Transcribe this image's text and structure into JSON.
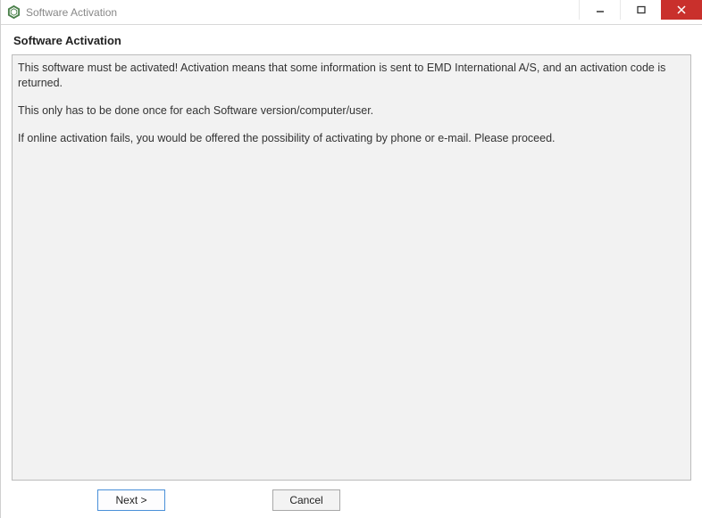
{
  "window": {
    "title": "Software Activation"
  },
  "heading": "Software Activation",
  "body": {
    "p1": "This software must be activated! Activation means that some information is sent to EMD International A/S, and an activation code is returned.",
    "p2": "This only has to be done once for each Software version/computer/user.",
    "p3": "If online activation fails, you would be offered the possibility of activating by phone or e-mail. Please proceed."
  },
  "buttons": {
    "next": "Next >",
    "cancel": "Cancel"
  }
}
